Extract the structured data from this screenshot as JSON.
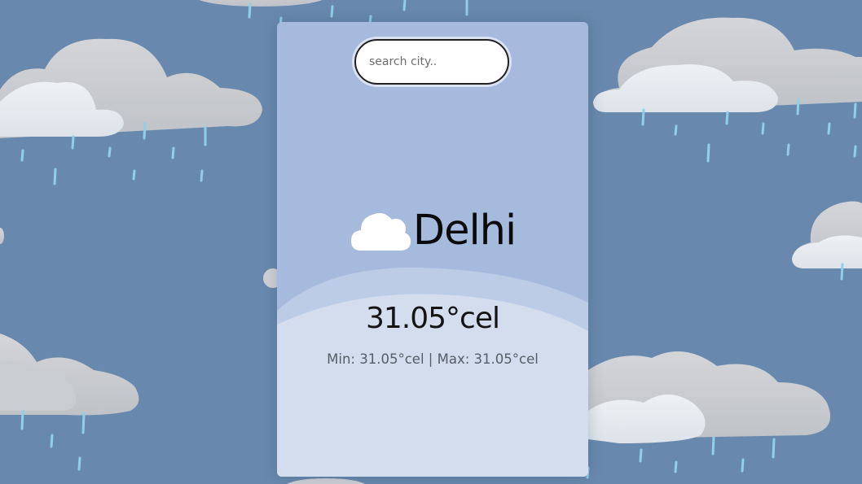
{
  "search": {
    "placeholder": "search city.."
  },
  "weather": {
    "city": "Delhi",
    "condition_icon": "cloud-icon",
    "temp": "31.05°cel",
    "min_label": "Min: 31.05°cel",
    "separator": "|",
    "max_label": "Max: 31.05°cel"
  },
  "colors": {
    "background": "#6889ad",
    "card": "#a6bade",
    "card_lower": "#d3ddee",
    "rain": "#8fd0e8",
    "cloud": "#e6eaee"
  },
  "background_scene": "rain clouds"
}
